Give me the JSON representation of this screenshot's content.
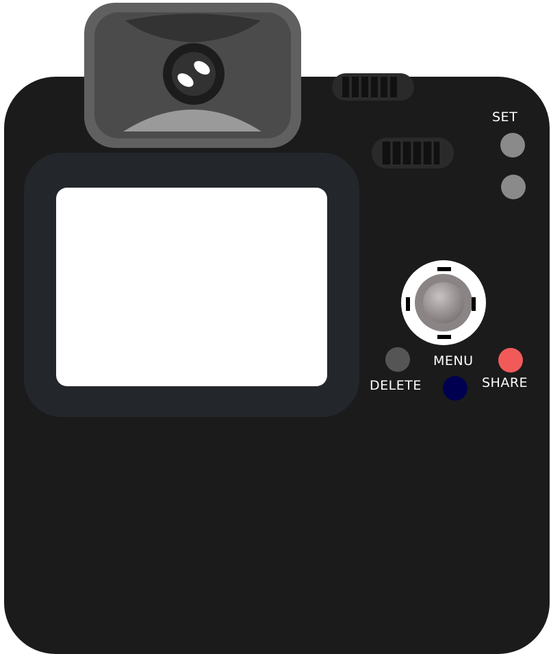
{
  "labels": {
    "set": "SET",
    "menu": "MENU",
    "delete": "DELETE",
    "share": "SHARE"
  },
  "colors": {
    "body": "#1b1b1b",
    "screen_bezel": "#23262b",
    "screen": "#ffffff",
    "viewfinder": "#606060",
    "set_button": "#8a8a8a",
    "delete_button": "#555555",
    "menu_button": "#000050",
    "share_button": "#f25a5a",
    "joystick": "#a8a2a2"
  },
  "icons": {
    "viewfinder": "viewfinder-icon",
    "dpad": "dpad-icon"
  }
}
